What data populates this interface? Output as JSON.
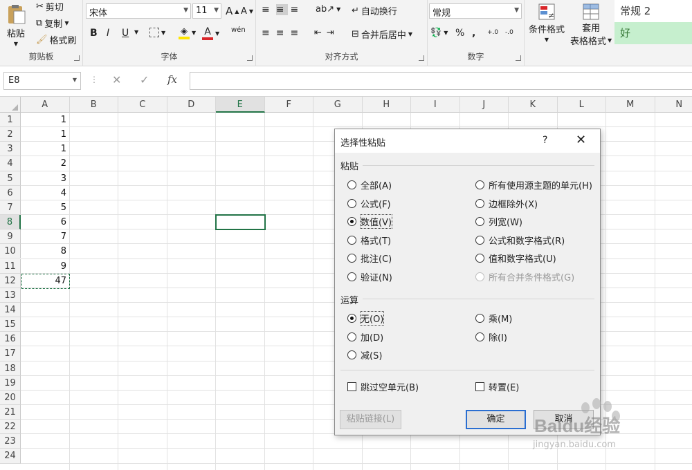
{
  "ribbon": {
    "clipboard": {
      "paste": "粘贴",
      "cut": "剪切",
      "copy": "复制",
      "format_painter": "格式刷",
      "label": "剪贴板"
    },
    "font": {
      "name": "宋体",
      "size": "11",
      "grow": "A",
      "shrink": "A",
      "bold": "B",
      "italic": "I",
      "underline": "U",
      "font_color": "A",
      "phonetic": "wén",
      "label": "字体"
    },
    "alignment": {
      "wrap_text": "自动换行",
      "merge_center": "合并后居中",
      "label": "对齐方式"
    },
    "number": {
      "format": "常规",
      "percent": "%",
      "comma": ",",
      "inc_dec": "+.0",
      "dec_dec": "-.0",
      "label": "数字"
    },
    "styles": {
      "conditional": "条件格式",
      "table_format_1": "套用",
      "table_format_2": "表格格式",
      "style_normal2": "常规 2",
      "style_good": "好"
    }
  },
  "formula_bar": {
    "name_box": "E8",
    "fx": "fx"
  },
  "sheet": {
    "columns": [
      "A",
      "B",
      "C",
      "D",
      "E",
      "F",
      "G",
      "H",
      "I",
      "J",
      "K",
      "L",
      "M",
      "N"
    ],
    "rows": [
      "1",
      "2",
      "3",
      "4",
      "5",
      "6",
      "7",
      "8",
      "9",
      "10",
      "11",
      "12",
      "13",
      "14",
      "15",
      "16",
      "17",
      "18",
      "19",
      "20",
      "21",
      "22",
      "23",
      "24"
    ],
    "col_a_values": [
      "1",
      "1",
      "1",
      "2",
      "3",
      "4",
      "5",
      "6",
      "7",
      "8",
      "9",
      "47"
    ]
  },
  "dialog": {
    "title": "选择性粘贴",
    "help": "?",
    "close": "✕",
    "paste_section": "粘贴",
    "paste_left": [
      "全部(A)",
      "公式(F)",
      "数值(V)",
      "格式(T)",
      "批注(C)",
      "验证(N)"
    ],
    "paste_right": [
      "所有使用源主题的单元(H)",
      "边框除外(X)",
      "列宽(W)",
      "公式和数字格式(R)",
      "值和数字格式(U)",
      "所有合并条件格式(G)"
    ],
    "op_section": "运算",
    "op_left": [
      "无(O)",
      "加(D)",
      "减(S)"
    ],
    "op_right": [
      "乘(M)",
      "除(I)"
    ],
    "skip_blanks": "跳过空单元(B)",
    "transpose": "转置(E)",
    "paste_link": "粘贴链接(L)",
    "ok": "确定",
    "cancel": "取消"
  },
  "watermark": {
    "brand": "Baidu经验",
    "url": "jingyan.baidu.com"
  },
  "colors": {
    "accent": "#217346",
    "default_button": "#2a6ed1",
    "font_color": "#d9262a",
    "highlight": "#ffe600",
    "good_style_bg": "#c6efce"
  }
}
